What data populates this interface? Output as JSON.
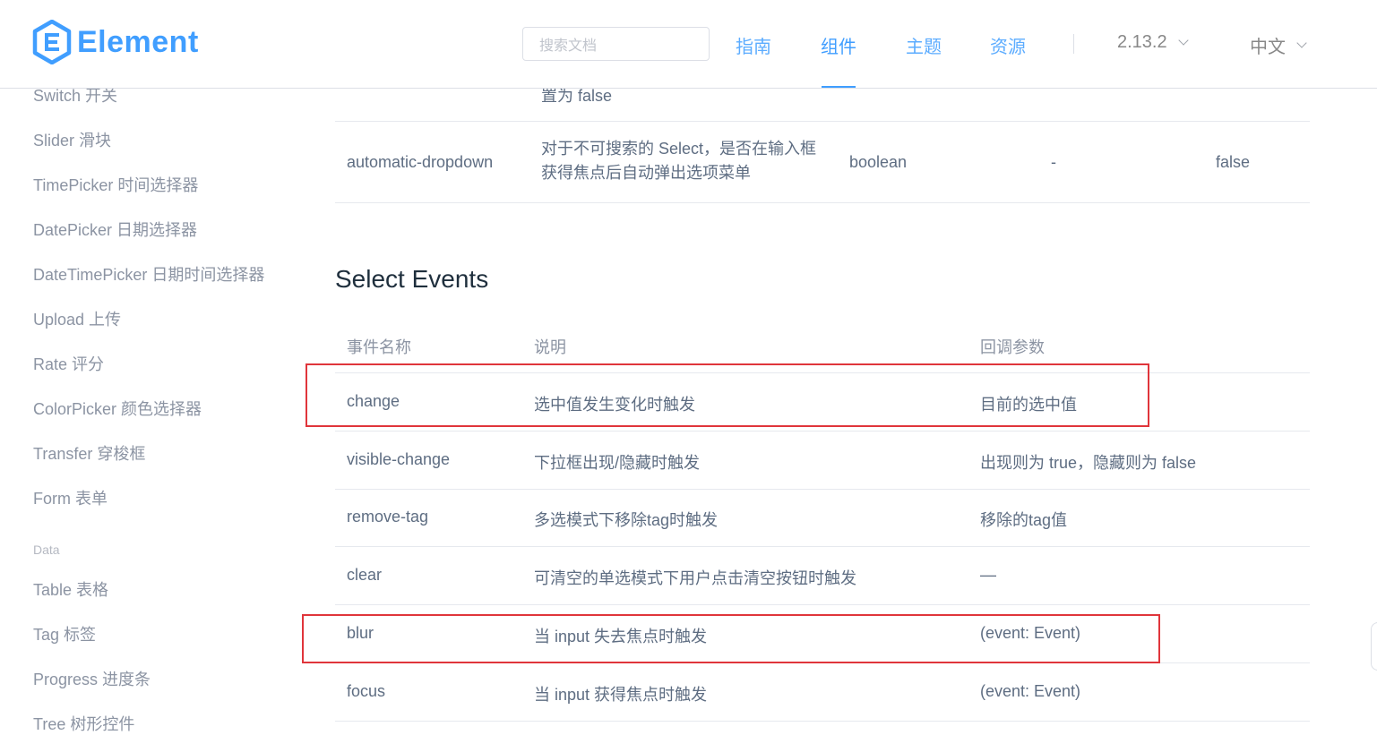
{
  "header": {
    "logo_text": "Element",
    "search_placeholder": "搜索文档",
    "nav": [
      "指南",
      "组件",
      "主题",
      "资源"
    ],
    "active_nav": "组件",
    "version": "2.13.2",
    "language": "中文"
  },
  "sidebar": {
    "items_top": [
      "Switch 开关",
      "Slider 滑块",
      "TimePicker 时间选择器",
      "DatePicker 日期选择器",
      "DateTimePicker 日期时间选择器",
      "Upload 上传",
      "Rate 评分",
      "ColorPicker 颜色选择器",
      "Transfer 穿梭框",
      "Form 表单"
    ],
    "group_label": "Data",
    "items_data": [
      "Table 表格",
      "Tag 标签",
      "Progress 进度条",
      "Tree 树形控件"
    ]
  },
  "attributes_fragment": {
    "partial_description": "置为 false",
    "row": {
      "name": "automatic-dropdown",
      "description": "对于不可搜索的 Select，是否在输入框获得焦点后自动弹出选项菜单",
      "type": "boolean",
      "accepted": "-",
      "default": "false"
    }
  },
  "events_section": {
    "title": "Select Events",
    "columns": [
      "事件名称",
      "说明",
      "回调参数"
    ],
    "rows": [
      {
        "name": "change",
        "description": "选中值发生变化时触发",
        "params": "目前的选中值"
      },
      {
        "name": "visible-change",
        "description": "下拉框出现/隐藏时触发",
        "params": "出现则为 true，隐藏则为 false"
      },
      {
        "name": "remove-tag",
        "description": "多选模式下移除tag时触发",
        "params": "移除的tag值"
      },
      {
        "name": "clear",
        "description": "可清空的单选模式下用户点击清空按钮时触发",
        "params": "—"
      },
      {
        "name": "blur",
        "description": "当 input 失去焦点时触发",
        "params": "(event: Event)"
      },
      {
        "name": "focus",
        "description": "当 input 获得焦点时触发",
        "params": "(event: Event)"
      }
    ]
  },
  "colors": {
    "brand": "#409eff",
    "highlight_box": "#e0353b"
  }
}
